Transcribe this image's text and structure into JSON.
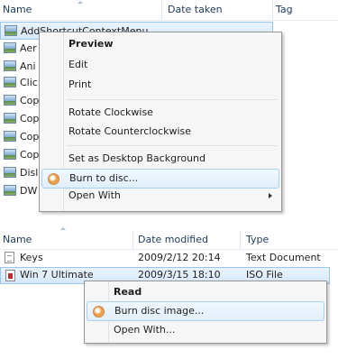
{
  "top": {
    "columns": {
      "name": "Name",
      "date": "Date taken",
      "tags": "Tag"
    },
    "files": [
      {
        "name": "AddShortcutContextMenu",
        "selected": true
      },
      {
        "name": "Aer"
      },
      {
        "name": "Ani"
      },
      {
        "name": "Clic"
      },
      {
        "name": "Cop"
      },
      {
        "name": "Cop"
      },
      {
        "name": "Cop"
      },
      {
        "name": "Cop"
      },
      {
        "name": "Disl"
      },
      {
        "name": "DW"
      }
    ],
    "menu": {
      "preview": "Preview",
      "edit": "Edit",
      "print": "Print",
      "rotate_cw": "Rotate Clockwise",
      "rotate_ccw": "Rotate Counterclockwise",
      "set_bg": "Set as Desktop Background",
      "burn": "Burn to disc...",
      "open_with": "Open With"
    }
  },
  "bottom": {
    "columns": {
      "name": "Name",
      "date": "Date modified",
      "type": "Type"
    },
    "rows": [
      {
        "name": "Keys",
        "date": "2009/2/12 20:14",
        "type": "Text Document"
      },
      {
        "name": "Win 7 Ultimate",
        "date": "2009/3/15 18:10",
        "type": "ISO File",
        "selected": true
      }
    ],
    "menu": {
      "read": "Read",
      "burn_image": "Burn disc image...",
      "open_with": "Open With..."
    }
  },
  "colors": {
    "selection": "#d6e8fb",
    "menu_bg": "#f6f6f6",
    "header_text": "#1e395b"
  }
}
